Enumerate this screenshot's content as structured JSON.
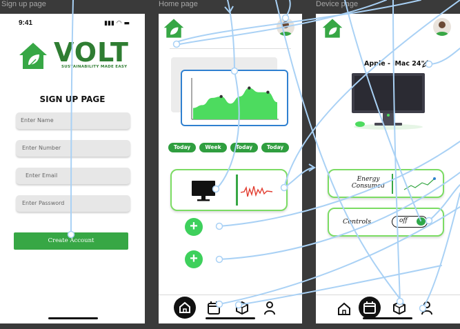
{
  "frames": {
    "signup": "Sign up page",
    "home": "Home page",
    "device": "Device page"
  },
  "status": {
    "time": "9:41",
    "icons": "▮▮▮ ◠ ▬"
  },
  "signup": {
    "brand": "VOLT",
    "tagline": "SUSTAINABILITY MADE EASY",
    "title": "SIGN UP PAGE",
    "fields": [
      "Enter Name",
      "Enter Number",
      "Enter Email",
      "Enter Password"
    ],
    "button": "Create Account"
  },
  "home": {
    "chart_data": {
      "type": "area",
      "values": [
        8,
        10,
        15,
        16,
        11,
        16,
        22,
        19,
        19,
        12
      ],
      "ylim": [
        0,
        30
      ],
      "color": "#4ddb5f"
    },
    "pills": [
      "Today",
      "Week",
      "Today",
      "Today"
    ]
  },
  "device": {
    "title": "Apple - iMac 24\"",
    "energy_label": "Energy Consumed",
    "controls_label": "Controls",
    "toggle_label": "off"
  },
  "colors": {
    "brand_green": "#2f9e3f",
    "accent_green": "#4ddb5f",
    "blue": "#2f80d0",
    "flow_line": "#a9d1f5"
  },
  "icons": {
    "nav": [
      "home-icon",
      "calendar-icon",
      "cube-icon",
      "profile-icon"
    ],
    "edit": "pencil-icon"
  }
}
